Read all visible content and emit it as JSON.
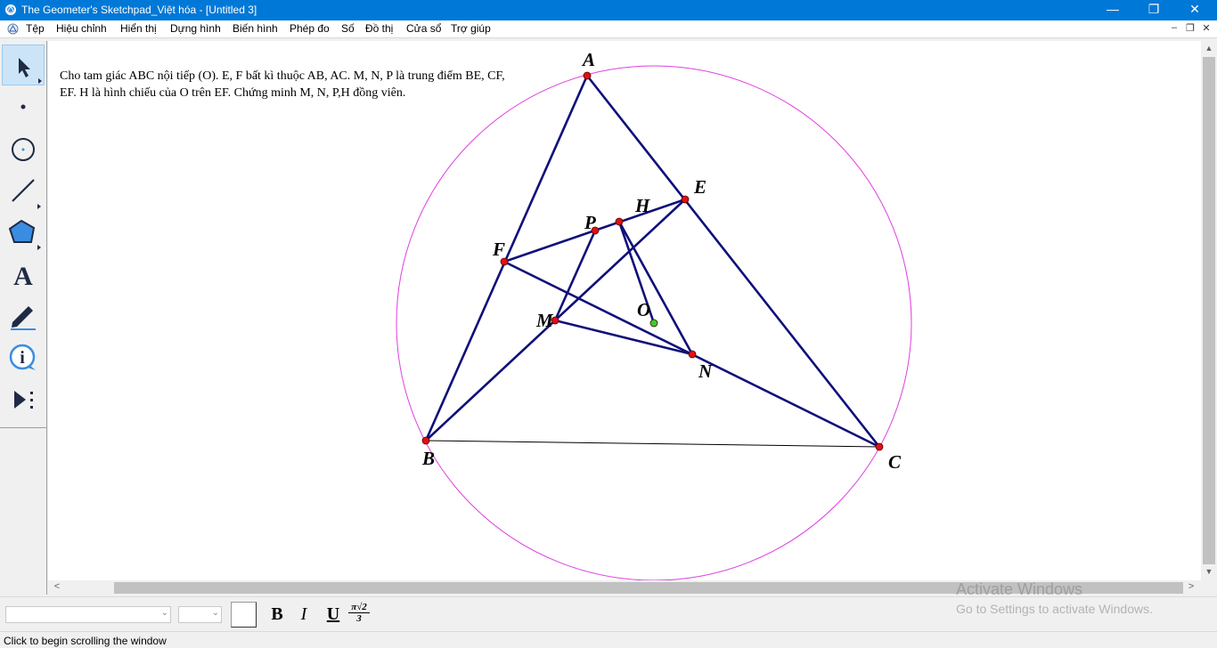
{
  "window": {
    "title": "The Geometer's Sketchpad_Việt hóa - [Untitled 3]",
    "controls": {
      "minimize": "—",
      "maximize": "❐",
      "close": "✕"
    }
  },
  "menu": {
    "items": [
      "Tệp",
      "Hiệu chỉnh",
      "Hiển thị",
      "Dựng hình",
      "Biến hình",
      "Phép đo",
      "Số",
      "Đồ thị",
      "Cửa sổ",
      "Trợ giúp"
    ],
    "mdi_controls": {
      "minimize": "–",
      "restore": "❐",
      "close": "✕"
    }
  },
  "toolbox": {
    "tools": [
      "arrow-tool",
      "point-tool",
      "compass-tool",
      "straightedge-tool",
      "polygon-tool",
      "text-tool",
      "marker-tool",
      "information-tool",
      "custom-tools"
    ],
    "text_tool_glyph": "A"
  },
  "canvas": {
    "problem_text": "Cho tam giác ABC nội tiếp (O). E, F bất kì thuộc AB, AC. M, N, P  là trung điểm BE, CF, EF. H là hình chiếu của O trên EF. Chứng minh M, N, P,H đồng viên."
  },
  "geometry": {
    "colors": {
      "segment": "#0f0f7a",
      "circle": "#e040e0",
      "point": "#e01010",
      "center_point": "#30d030",
      "chord": "#000000"
    },
    "points": [
      {
        "label": "A"
      },
      {
        "label": "B"
      },
      {
        "label": "C"
      },
      {
        "label": "E"
      },
      {
        "label": "F"
      },
      {
        "label": "P"
      },
      {
        "label": "H"
      },
      {
        "label": "M"
      },
      {
        "label": "N"
      },
      {
        "label": "O"
      }
    ]
  },
  "format_bar": {
    "bold": "B",
    "italic": "I",
    "underline": "U",
    "math_top": "π√2",
    "math_bottom": "3"
  },
  "watermark": {
    "line1": "Activate Windows",
    "line2": "Go to Settings to activate Windows."
  },
  "status": {
    "text": "Click to begin scrolling the window"
  },
  "scrollbars": {
    "left": "<",
    "right": ">",
    "up": "^",
    "down": "v"
  }
}
